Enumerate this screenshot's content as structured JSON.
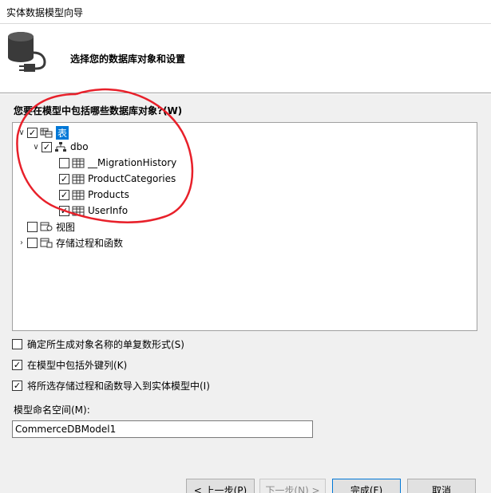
{
  "window": {
    "title": "实体数据模型向导"
  },
  "header": {
    "subtitle": "选择您的数据库对象和设置"
  },
  "tree": {
    "question": "您要在模型中包括哪些数据库对象?(W)",
    "root_tables": {
      "label": "表",
      "checked": true,
      "expanded": true
    },
    "schema": {
      "label": "dbo",
      "checked": true,
      "expanded": true
    },
    "tables": [
      {
        "label": "__MigrationHistory",
        "checked": false
      },
      {
        "label": "ProductCategories",
        "checked": true
      },
      {
        "label": "Products",
        "checked": true
      },
      {
        "label": "UserInfo",
        "checked": true
      }
    ],
    "views": {
      "label": "视图",
      "checked": false
    },
    "procs": {
      "label": "存储过程和函数",
      "checked": false,
      "expanded": false
    }
  },
  "options": [
    {
      "label": "确定所生成对象名称的单复数形式(S)",
      "checked": false
    },
    {
      "label": "在模型中包括外键列(K)",
      "checked": true
    },
    {
      "label": "将所选存储过程和函数导入到实体模型中(I)",
      "checked": true
    }
  ],
  "namespace": {
    "label": "模型命名空间(M):",
    "value": "CommerceDBModel1"
  },
  "buttons": {
    "prev": "< 上一步(P)",
    "next": "下一步(N) >",
    "finish": "完成(F)",
    "cancel": "取消"
  },
  "colors": {
    "selection": "#0078d7",
    "annotation": "#e8202a",
    "panel": "#f0f0f0"
  }
}
